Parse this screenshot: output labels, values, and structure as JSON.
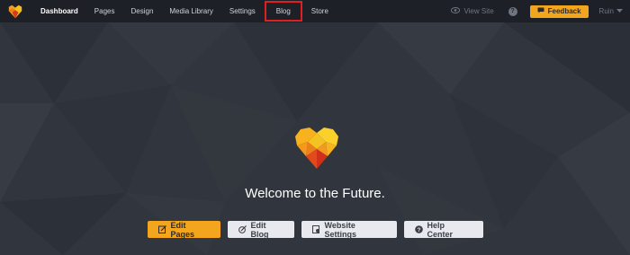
{
  "nav": {
    "items": [
      {
        "label": "Dashboard",
        "active": true
      },
      {
        "label": "Pages"
      },
      {
        "label": "Design"
      },
      {
        "label": "Media Library"
      },
      {
        "label": "Settings"
      },
      {
        "label": "Blog",
        "highlighted": true
      },
      {
        "label": "Store"
      }
    ]
  },
  "topbar_right": {
    "view_site_label": "View Site",
    "help_label": "?",
    "feedback_label": "Feedback",
    "user_label": "Ruin"
  },
  "hero": {
    "welcome_text": "Welcome to the Future."
  },
  "actions": {
    "edit_pages": "Edit Pages",
    "edit_blog": "Edit Blog",
    "website_settings": "Website Settings",
    "help_center": "Help Center"
  },
  "colors": {
    "accent": "#f3a51d",
    "topbar": "#1d2026",
    "background": "#2f343c",
    "highlight_box": "#e02020"
  },
  "icons": [
    "logo-heart-icon",
    "eye-icon",
    "help-icon",
    "chat-bubble-icon",
    "chevron-down-icon",
    "edit-icon",
    "edit-blog-icon",
    "settings-doc-icon",
    "question-circle-icon"
  ]
}
